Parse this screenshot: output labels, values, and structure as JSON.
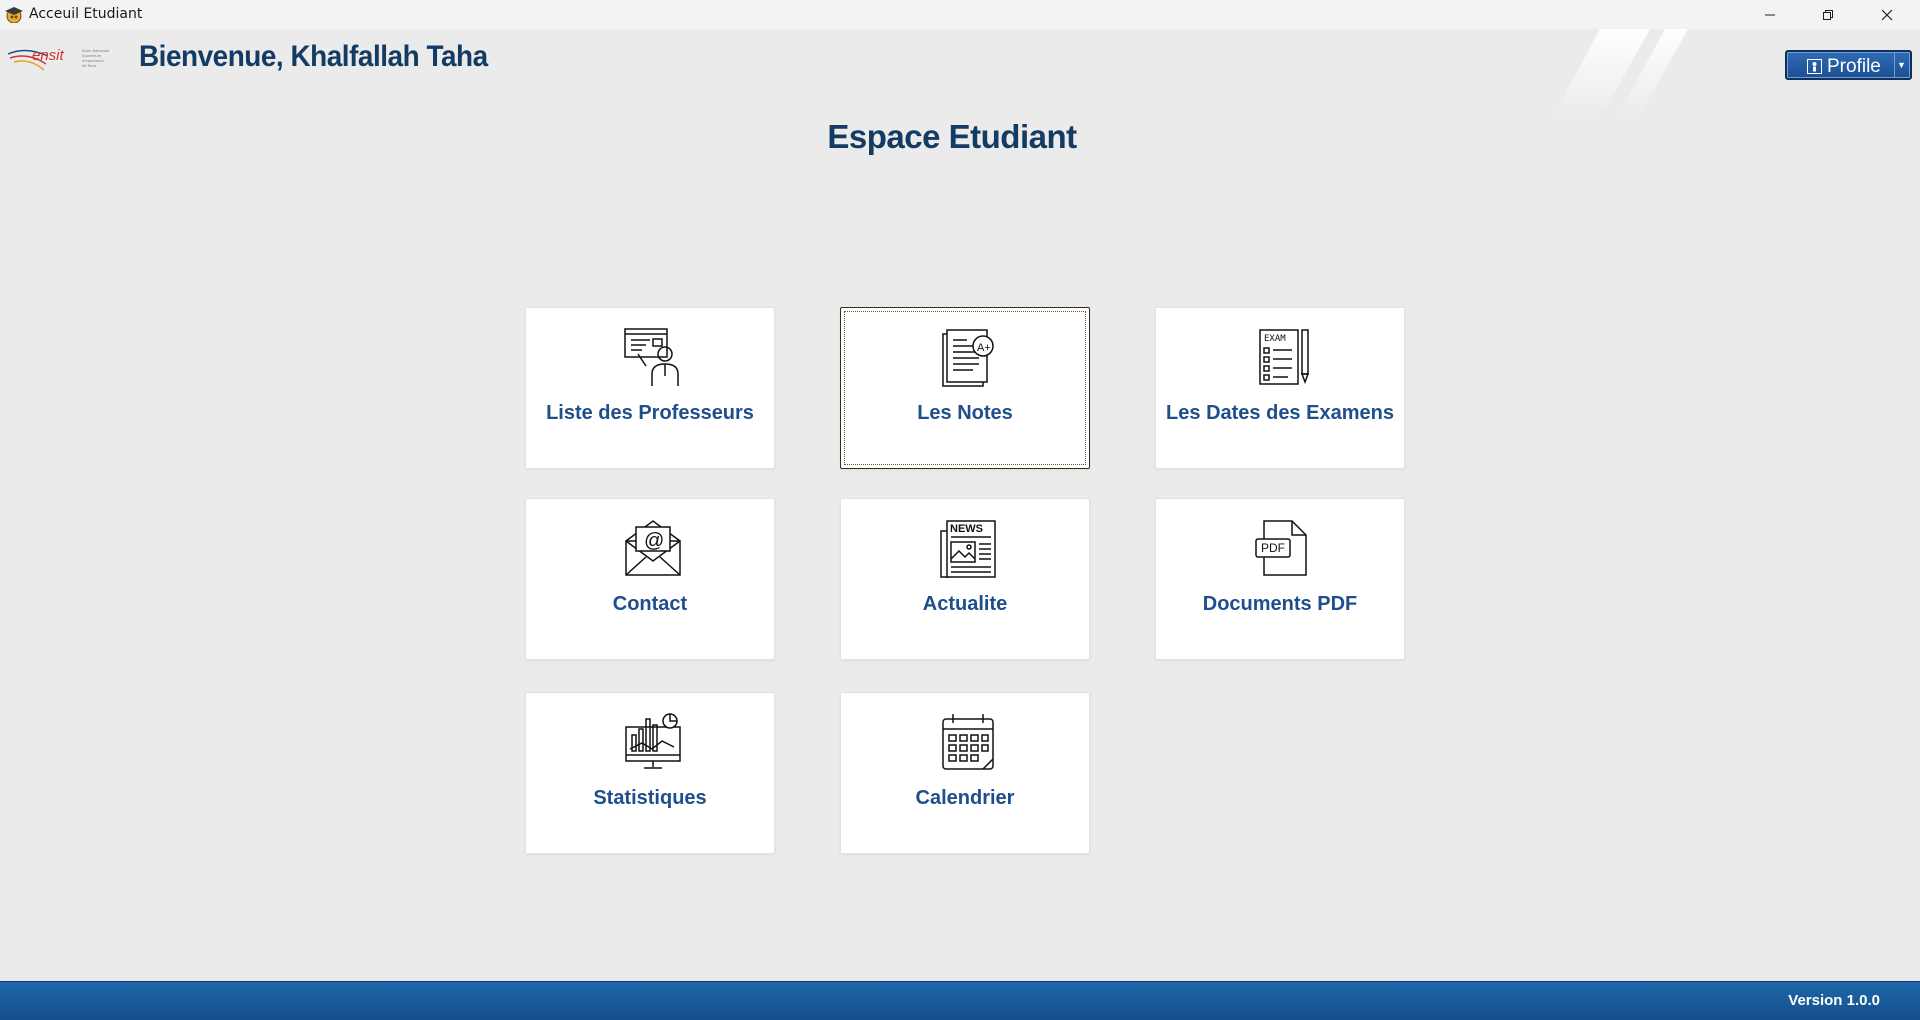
{
  "window": {
    "title": "Acceuil Etudiant",
    "icon": "graduation-cap-icon"
  },
  "header": {
    "logo": "ensit-logo",
    "welcome": "Bienvenue, Khalfallah Taha",
    "profile_label": "Profile"
  },
  "main": {
    "title": "Espace Etudiant",
    "tiles": [
      {
        "label": "Liste des Professeurs",
        "icon": "teacher-icon"
      },
      {
        "label": "Les Notes",
        "icon": "grades-icon",
        "selected": true
      },
      {
        "label": "Les Dates des Examens",
        "icon": "exam-icon"
      },
      {
        "label": "Contact",
        "icon": "mail-icon"
      },
      {
        "label": "Actualite",
        "icon": "news-icon"
      },
      {
        "label": "Documents PDF",
        "icon": "pdf-icon"
      },
      {
        "label": "Statistiques",
        "icon": "statistics-icon"
      },
      {
        "label": "Calendrier",
        "icon": "calendar-icon"
      }
    ]
  },
  "footer": {
    "version": "Version 1.0.0"
  },
  "colors": {
    "accent": "#143b63",
    "tile_label": "#1e4e8c",
    "footer": "#1a5c9c"
  }
}
